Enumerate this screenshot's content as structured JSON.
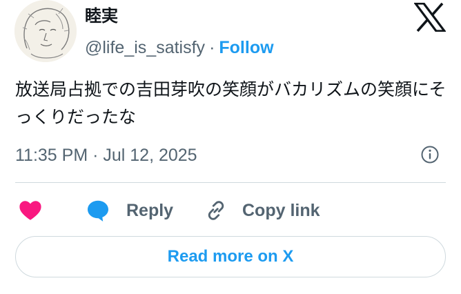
{
  "author": {
    "display_name": "睦実",
    "handle": "@life_is_satisfy",
    "separator": "·",
    "follow_label": "Follow"
  },
  "tweet": {
    "text": "放送局占拠での吉田芽吹の笑顔がバカリズムの笑顔にそっくりだったな",
    "timestamp": "11:35 PM · Jul 12, 2025"
  },
  "actions": {
    "reply_label": "Reply",
    "copy_link_label": "Copy link"
  },
  "read_more_label": "Read more on X",
  "icons": {
    "brand": "x-logo-icon",
    "info": "info-icon",
    "like": "heart-icon",
    "reply": "speech-bubble-icon",
    "copy": "link-icon"
  },
  "colors": {
    "accent": "#1d9bf0",
    "heart": "#f91880",
    "secondary_text": "#536471",
    "border": "#cfd9de",
    "text": "#0f1419"
  }
}
